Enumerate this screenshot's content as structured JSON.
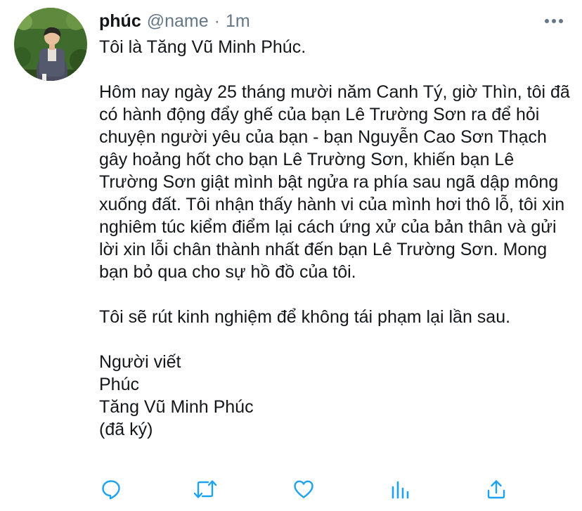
{
  "tweet": {
    "author": {
      "display_name": "phúc",
      "handle": "@name",
      "separator": "·",
      "time": "1m"
    },
    "body": {
      "line_intro": "Tôi là Tăng Vũ Minh Phúc.",
      "paragraph_main": "Hôm nay ngày 25 tháng mười năm Canh Tý, giờ Thìn, tôi đã có hành động đẩy ghế của bạn Lê Trường Sơn ra để hỏi chuyện người yêu của bạn - bạn Nguyễn Cao Sơn Thạch gây hoảng hốt cho bạn Lê Trường Sơn, khiến bạn Lê Trường Sơn giật mình bật ngửa ra phía sau ngã dập mông xuống đất. Tôi nhận thấy hành vi của mình hơi thô lỗ, tôi xin nghiêm túc kiểm điểm lại cách ứng xử của bản thân và gửi lời xin lỗi chân thành nhất đến bạn Lê Trường Sơn. Mong bạn bỏ qua cho sự hồ đồ của tôi.",
      "paragraph_promise": "Tôi sẽ rút kinh nghiệm để không tái phạm lại lần sau.",
      "signature": {
        "label": "Người viết",
        "short_name": "Phúc",
        "full_name": "Tăng Vũ Minh Phúc",
        "signed_note": "(đã ký)"
      }
    },
    "actions": [
      {
        "icon": "reply-icon"
      },
      {
        "icon": "retweet-icon"
      },
      {
        "icon": "like-icon"
      },
      {
        "icon": "analytics-icon"
      },
      {
        "icon": "share-icon"
      }
    ]
  },
  "colors": {
    "text_primary": "#14171a",
    "text_secondary": "#657786",
    "icon": "#1da1f2",
    "background": "#ffffff"
  }
}
